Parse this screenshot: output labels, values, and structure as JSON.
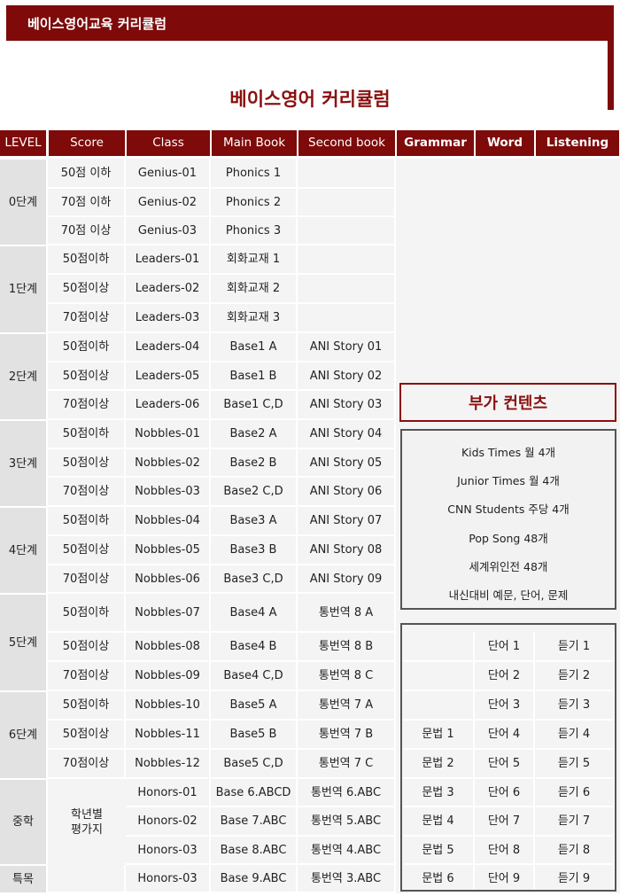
{
  "banner": {
    "title": "베이스영어교육 커리큘럼"
  },
  "document": {
    "title": "베이스영어 커리큘럼"
  },
  "headers": [
    "LEVEL",
    "Score",
    "Class",
    "Main Book",
    "Second book",
    "Grammar",
    "Word",
    "Listening"
  ],
  "levels": [
    {
      "label": "0단계",
      "rows": [
        [
          "50점 이하",
          "Genius-01",
          "Phonics 1",
          ""
        ],
        [
          "70점 이하",
          "Genius-02",
          "Phonics 2",
          ""
        ],
        [
          "70점 이상",
          "Genius-03",
          "Phonics 3",
          ""
        ]
      ]
    },
    {
      "label": "1단계",
      "rows": [
        [
          "50점이하",
          "Leaders-01",
          "회화교재 1",
          ""
        ],
        [
          "50점이상",
          "Leaders-02",
          "회화교재 2",
          ""
        ],
        [
          "70점이상",
          "Leaders-03",
          "회화교재 3",
          ""
        ]
      ]
    },
    {
      "label": "2단계",
      "rows": [
        [
          "50점이하",
          "Leaders-04",
          "Base1 A",
          "ANI Story 01"
        ],
        [
          "50점이상",
          "Leaders-05",
          "Base1 B",
          "ANI Story 02"
        ],
        [
          "70점이상",
          "Leaders-06",
          "Base1 C,D",
          "ANI Story 03"
        ]
      ]
    },
    {
      "label": "3단계",
      "rows": [
        [
          "50점이하",
          "Nobbles-01",
          "Base2 A",
          "ANI Story 04"
        ],
        [
          "50점이상",
          "Nobbles-02",
          "Base2 B",
          "ANI Story 05"
        ],
        [
          "70점이상",
          "Nobbles-03",
          "Base2 C,D",
          "ANI Story 06"
        ]
      ]
    },
    {
      "label": "4단계",
      "rows": [
        [
          "50점이하",
          "Nobbles-04",
          "Base3 A",
          "ANI Story 07"
        ],
        [
          "50점이상",
          "Nobbles-05",
          "Base3 B",
          "ANI Story 08"
        ],
        [
          "70점이상",
          "Nobbles-06",
          "Base3 C,D",
          "ANI Story 09"
        ]
      ]
    },
    {
      "label": "5단계",
      "rows": [
        [
          "50점이하",
          "Nobbles-07",
          "Base4 A",
          "통번역 8 A"
        ],
        [
          "50점이상",
          "Nobbles-08",
          "Base4 B",
          "통번역 8 B"
        ],
        [
          "70점이상",
          "Nobbles-09",
          "Base4 C,D",
          "통번역 8 C"
        ]
      ]
    },
    {
      "label": "6단계",
      "rows": [
        [
          "50점이하",
          "Nobbles-10",
          "Base5 A",
          "통번역 7 A"
        ],
        [
          "50점이상",
          "Nobbles-11",
          "Base5 B",
          "통번역 7 B"
        ],
        [
          "70점이상",
          "Nobbles-12",
          "Base5 C,D",
          "통번역 7 C"
        ]
      ]
    },
    {
      "label": "중학",
      "score": "학년별\n평가지",
      "rows": [
        [
          "",
          "Honors-01",
          "Base 6.ABCD",
          "통번역 6.ABC"
        ],
        [
          "",
          "Honors-02",
          "Base 7.ABC",
          "통번역 5.ABC"
        ],
        [
          "",
          "Honors-03",
          "Base 8.ABC",
          "통번역 4.ABC"
        ]
      ]
    },
    {
      "label": "특목",
      "rows": [
        [
          "",
          "Honors-03",
          "Base 9.ABC",
          "통번역 3.ABC"
        ]
      ]
    }
  ],
  "addon": {
    "title": "부가 컨텐츠",
    "items": [
      "Kids Times 월 4개",
      "Junior Times 월  4개",
      "CNN Students 주당 4개",
      "Pop Song 48개",
      "세계위인전 48개",
      "내신대비 예문, 단어, 문제"
    ]
  },
  "gwl_rows": [
    [
      "",
      "단어 1",
      "듣기 1"
    ],
    [
      "",
      "단어 2",
      "듣기 2"
    ],
    [
      "",
      "단어 3",
      "듣기 3"
    ],
    [
      "문법 1",
      "단어 4",
      "듣기 4"
    ],
    [
      "문법 2",
      "단어 5",
      "듣기 5"
    ],
    [
      "문법 3",
      "단어 6",
      "듣기 6"
    ],
    [
      "문법 4",
      "단어 7",
      "듣기 7"
    ],
    [
      "문법 5",
      "단어 8",
      "듣기 8"
    ],
    [
      "문법 6",
      "단어 9",
      "듣기 9"
    ]
  ]
}
